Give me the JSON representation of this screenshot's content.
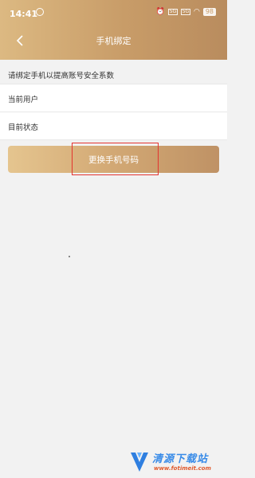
{
  "status_bar": {
    "time": "14:41",
    "signal_1": "5G",
    "signal_2": "5G",
    "battery": "98"
  },
  "nav": {
    "title": "手机绑定",
    "back_icon": "chevron-left-icon"
  },
  "hint": "请绑定手机以提高账号安全系数",
  "info_rows": [
    {
      "label": "当前用户"
    },
    {
      "label": "目前状态"
    }
  ],
  "change_button_label": "更换手机号码",
  "colors": {
    "header_gradient": [
      "#dcb982",
      "#b98c5e"
    ],
    "button_gradient": [
      "#e5c58f",
      "#bf9265"
    ],
    "highlight": "#e3342f"
  },
  "watermark": {
    "title": "清源下载站",
    "url": "www.fotimeit.com"
  }
}
